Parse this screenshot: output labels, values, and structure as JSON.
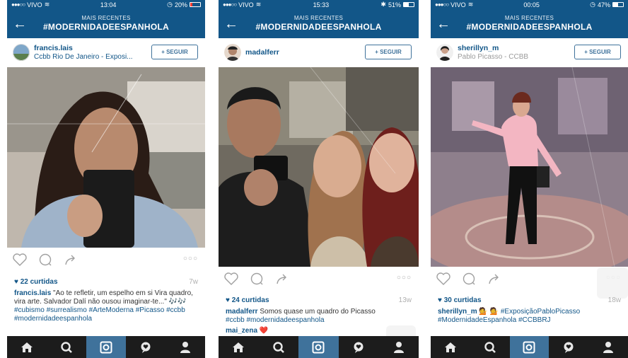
{
  "colors": {
    "brand": "#125688",
    "link": "#3f729b",
    "tabbar": "#1c1c1c",
    "like": "#125688"
  },
  "header": {
    "subtitle": "MAIS RECENTES",
    "title": "#MODERNIDADEESPANHOLA"
  },
  "follow_label": "+ SEGUIR",
  "tabs": [
    "home-icon",
    "search-icon",
    "camera-icon",
    "activity-icon",
    "profile-icon"
  ],
  "posts": [
    {
      "status": {
        "carrier": "VIVO",
        "time": "13:04",
        "battery": "20%",
        "battery_level": 0.2
      },
      "user": "francis.lais",
      "location": "Ccbb Rio De Janeiro - Exposi...",
      "likes": "22 curtidas",
      "age": "7w",
      "caption_text": "\"Ao te refletir, um espelho em si Vira quadro, vira arte. Salvador Dalí não ousou imaginar-te...\" 🎶🎶",
      "tags": "#cubismo #surrealismo #ArteModerna #Picasso #ccbb #modernidadeespanhola"
    },
    {
      "status": {
        "carrier": "VIVO",
        "time": "15:33",
        "battery": "51%",
        "battery_level": 0.51
      },
      "user": "madalferr",
      "location": "",
      "likes": "24 curtidas",
      "age": "13w",
      "caption_text": "Somos quase um quadro do Picasso",
      "tags": "#ccbb #modernidadeespanhola",
      "comment_user": "mai_zena",
      "comment_text": "❤️"
    },
    {
      "status": {
        "carrier": "VIVO",
        "time": "00:05",
        "battery": "47%",
        "battery_level": 0.47
      },
      "user": "sherillyn_m",
      "location": "Pablo Picasso - CCBB",
      "likes": "30 curtidas",
      "age": "18w",
      "caption_text": "💁 💁 #ExposiçãoPabloPicasso",
      "tags": "#ModernidadeEspanhola #CCBBRJ"
    }
  ]
}
